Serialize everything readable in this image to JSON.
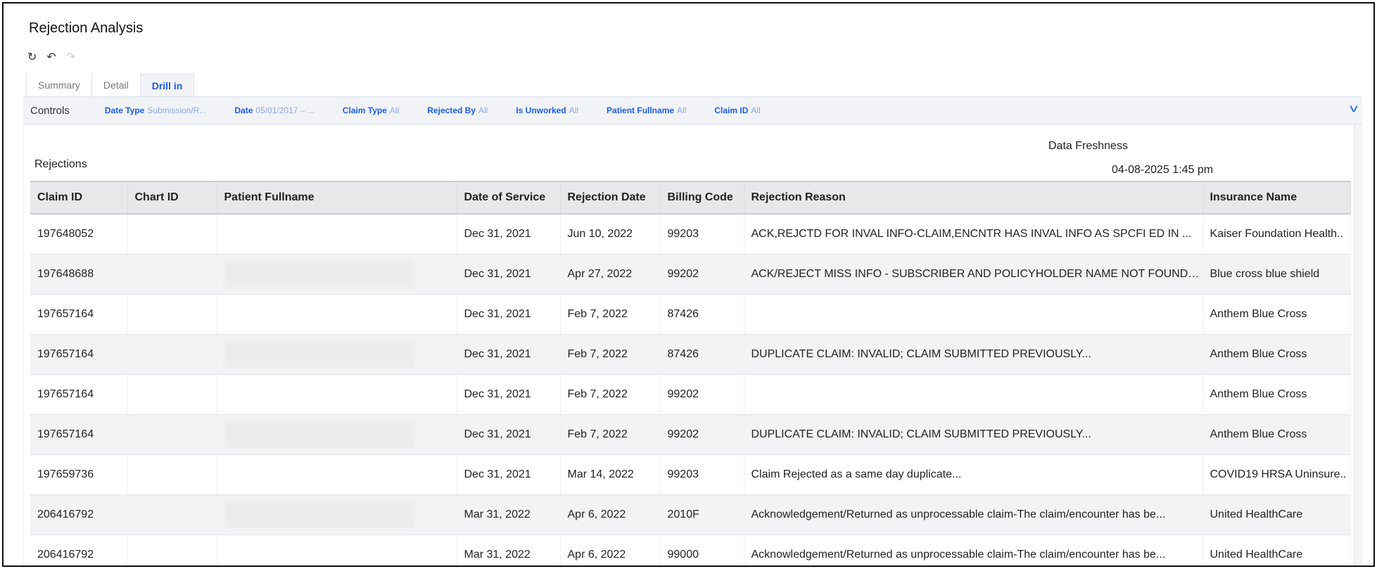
{
  "title": "Rejection Analysis",
  "toolbar": {
    "icons": [
      "reset-icon",
      "undo-icon",
      "redo-icon"
    ]
  },
  "tabs": [
    {
      "label": "Summary"
    },
    {
      "label": "Detail"
    },
    {
      "label": "Drill in"
    }
  ],
  "controls": {
    "label": "Controls",
    "filters": [
      {
        "name": "Date Type",
        "value": "Submission/R..."
      },
      {
        "name": "Date",
        "value": "05/01/2017 – ..."
      },
      {
        "name": "Claim Type",
        "value": "All"
      },
      {
        "name": "Rejected By",
        "value": "All"
      },
      {
        "name": "Is Unworked",
        "value": "All"
      },
      {
        "name": "Patient Fullname",
        "value": "All"
      },
      {
        "name": "Claim ID",
        "value": "All"
      }
    ]
  },
  "freshness": {
    "label": "Data Freshness",
    "value": "04-08-2025 1:45 pm"
  },
  "table": {
    "title": "Rejections",
    "columns": [
      "Claim ID",
      "Chart ID",
      "Patient Fullname",
      "Date of Service",
      "Rejection Date",
      "Billing Code",
      "Rejection Reason",
      "Insurance Name"
    ],
    "rows": [
      [
        "197648052",
        "",
        "",
        "Dec 31, 2021",
        "Jun 10, 2022",
        "99203",
        "ACK,REJCTD FOR INVAL INFO-CLAIM,ENCNTR HAS INVAL INFO AS SPCFI ED IN ...",
        "Kaiser Foundation Health.."
      ],
      [
        "197648688",
        "",
        "",
        "Dec 31, 2021",
        "Apr 27, 2022",
        "99202",
        "ACK/REJECT MISS INFO - SUBSCRIBER AND POLICYHOLDER NAME NOT FOUND. ...",
        "Blue cross blue shield"
      ],
      [
        "197657164",
        "",
        "",
        "Dec 31, 2021",
        "Feb 7, 2022",
        "87426",
        "",
        "Anthem Blue Cross"
      ],
      [
        "197657164",
        "",
        "",
        "Dec 31, 2021",
        "Feb 7, 2022",
        "87426",
        "DUPLICATE CLAIM: INVALID; CLAIM SUBMITTED PREVIOUSLY...",
        "Anthem Blue Cross"
      ],
      [
        "197657164",
        "",
        "",
        "Dec 31, 2021",
        "Feb 7, 2022",
        "99202",
        "",
        "Anthem Blue Cross"
      ],
      [
        "197657164",
        "",
        "",
        "Dec 31, 2021",
        "Feb 7, 2022",
        "99202",
        "DUPLICATE CLAIM: INVALID; CLAIM SUBMITTED PREVIOUSLY...",
        "Anthem Blue Cross"
      ],
      [
        "197659736",
        "",
        "",
        "Dec 31, 2021",
        "Mar 14, 2022",
        "99203",
        "Claim Rejected as a same day duplicate...",
        "COVID19 HRSA Uninsure.."
      ],
      [
        "206416792",
        "",
        "",
        "Mar 31, 2022",
        "Apr 6, 2022",
        "2010F",
        "Acknowledgement/Returned as unprocessable claim-The claim/encounter has be...",
        "United HealthCare"
      ],
      [
        "206416792",
        "",
        "",
        "Mar 31, 2022",
        "Apr 6, 2022",
        "99000",
        "Acknowledgement/Returned as unprocessable claim-The claim/encounter has be...",
        "United HealthCare"
      ]
    ]
  },
  "colors": {
    "accent": "#1a5ce6",
    "accent_light": "#8aa8e8",
    "controls_bg": "#f2f3f6",
    "header_bg": "#e8e8ea"
  }
}
